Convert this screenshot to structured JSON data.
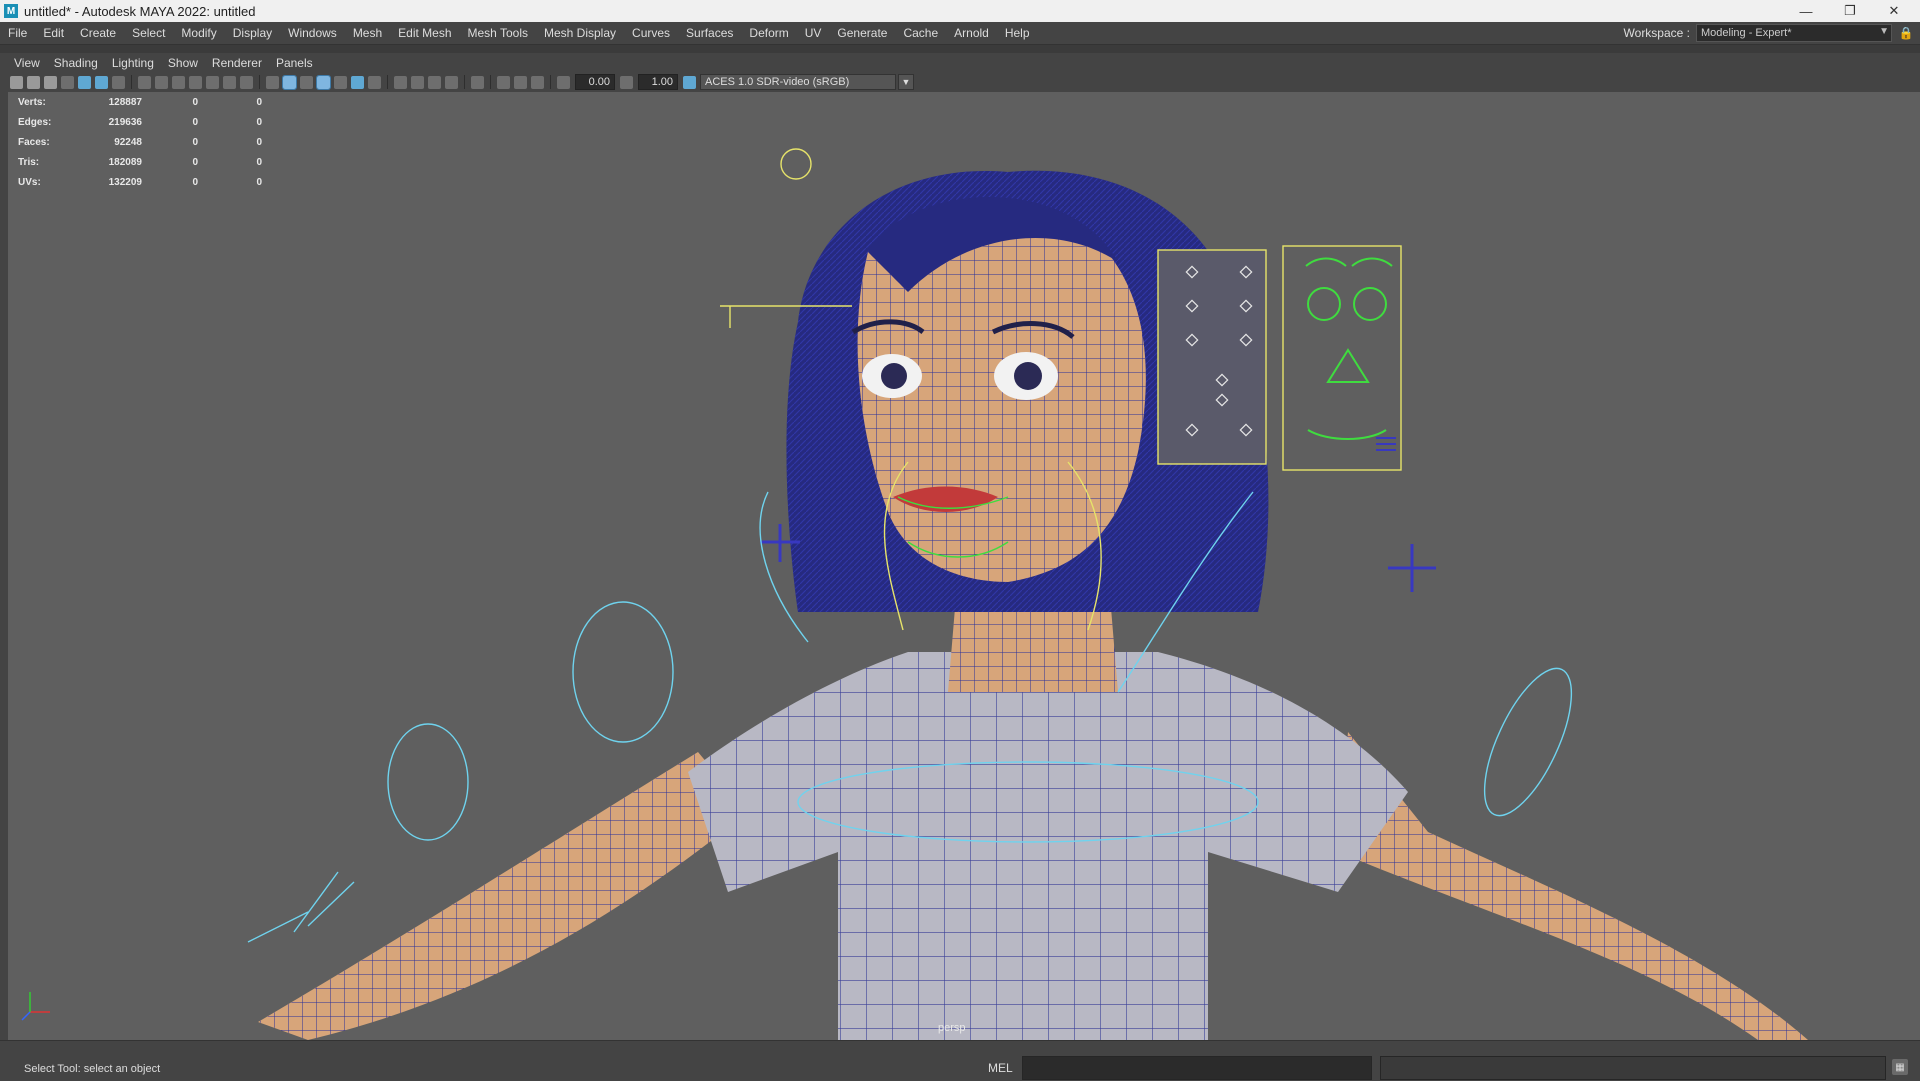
{
  "window": {
    "title": "untitled* - Autodesk MAYA 2022: untitled"
  },
  "menubar": {
    "items": [
      "File",
      "Edit",
      "Create",
      "Select",
      "Modify",
      "Display",
      "Windows",
      "Mesh",
      "Edit Mesh",
      "Mesh Tools",
      "Mesh Display",
      "Curves",
      "Surfaces",
      "Deform",
      "UV",
      "Generate",
      "Cache",
      "Arnold",
      "Help"
    ]
  },
  "workspace": {
    "label": "Workspace :",
    "value": "Modeling - Expert*"
  },
  "panel_menu": {
    "items": [
      "View",
      "Shading",
      "Lighting",
      "Show",
      "Renderer",
      "Panels"
    ]
  },
  "toolbar": {
    "exposure": "0.00",
    "gamma": "1.00",
    "color_space": "ACES 1.0 SDR-video (sRGB)"
  },
  "hud": {
    "rows": [
      {
        "label": "Verts:",
        "values": [
          "128887",
          "0",
          "0"
        ]
      },
      {
        "label": "Edges:",
        "values": [
          "219636",
          "0",
          "0"
        ]
      },
      {
        "label": "Faces:",
        "values": [
          "92248",
          "0",
          "0"
        ]
      },
      {
        "label": "Tris:",
        "values": [
          "182089",
          "0",
          "0"
        ]
      },
      {
        "label": "UVs:",
        "values": [
          "132209",
          "0",
          "0"
        ]
      }
    ]
  },
  "viewport": {
    "camera": "persp"
  },
  "status": {
    "help_line": "Select Tool: select an object",
    "command_lang": "MEL"
  },
  "colors": {
    "wire": "#2a2e9a",
    "skin": "#d7a57a",
    "shirt": "#b8b8c4",
    "control_cyan": "#6fd3ee",
    "control_yellow": "#e6e36a",
    "control_green": "#3fdc3f",
    "viewport_bg": "#5f5f5f"
  }
}
